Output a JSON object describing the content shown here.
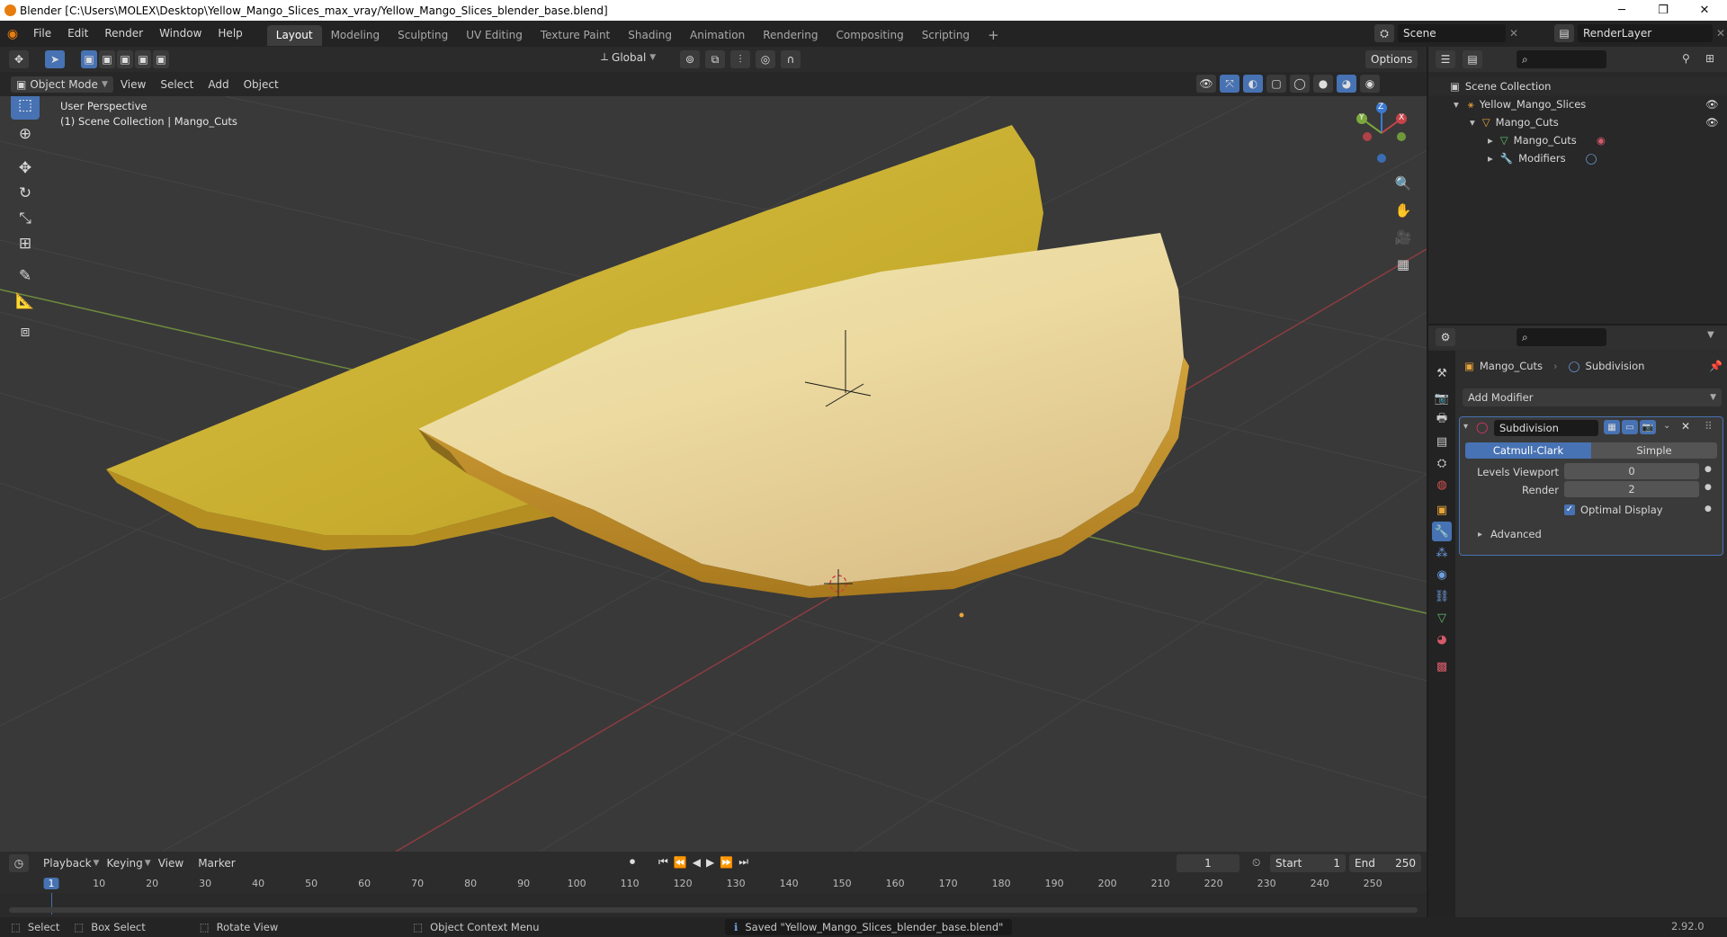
{
  "window": {
    "title": "Blender [C:\\Users\\MOLEX\\Desktop\\Yellow_Mango_Slices_max_vray/Yellow_Mango_Slices_blender_base.blend]",
    "minimize": "─",
    "maximize": "❐",
    "close": "✕"
  },
  "menu": [
    "File",
    "Edit",
    "Render",
    "Window",
    "Help"
  ],
  "workspaces": [
    "Layout",
    "Modeling",
    "Sculpting",
    "UV Editing",
    "Texture Paint",
    "Shading",
    "Animation",
    "Rendering",
    "Compositing",
    "Scripting"
  ],
  "active_workspace": "Layout",
  "add_workspace": "+",
  "scene": {
    "name": "Scene",
    "render_layer": "RenderLayer"
  },
  "viewport_toolbar": {
    "orientation": "Global",
    "options": "Options"
  },
  "viewport_header": {
    "mode": "Object Mode",
    "menus": [
      "View",
      "Select",
      "Add",
      "Object"
    ]
  },
  "viewport": {
    "perspective": "User Perspective",
    "collection_info": "(1) Scene Collection | Mango_Cuts",
    "gizmo": {
      "x": "X",
      "y": "Y",
      "z": "Z"
    }
  },
  "outliner": {
    "root": "Scene Collection",
    "items": [
      {
        "label": "Yellow_Mango_Slices",
        "depth": 1,
        "expand": "▾"
      },
      {
        "label": "Mango_Cuts",
        "depth": 2,
        "expand": "▾"
      },
      {
        "label": "Mango_Cuts",
        "depth": 3,
        "expand": "▸"
      },
      {
        "label": "Modifiers",
        "depth": 3,
        "expand": "▸"
      }
    ]
  },
  "properties": {
    "object_name": "Mango_Cuts",
    "modifier_breadcrumb": "Subdivision",
    "add_modifier": "Add Modifier",
    "modifier": {
      "name": "Subdivision",
      "type_options": [
        "Catmull-Clark",
        "Simple"
      ],
      "selected_type": "Catmull-Clark",
      "levels_viewport_label": "Levels Viewport",
      "levels_viewport": "0",
      "render_label": "Render",
      "render": "2",
      "optimal_display_label": "Optimal Display",
      "optimal_display": true,
      "advanced_label": "Advanced"
    }
  },
  "timeline": {
    "menus": [
      "Playback",
      "Keying",
      "View",
      "Marker"
    ],
    "current_frame": "1",
    "start_label": "Start",
    "start": "1",
    "end_label": "End",
    "end": "250",
    "ticks": [
      "1",
      "10",
      "20",
      "30",
      "40",
      "50",
      "60",
      "70",
      "80",
      "90",
      "100",
      "110",
      "120",
      "130",
      "140",
      "150",
      "160",
      "170",
      "180",
      "190",
      "200",
      "210",
      "220",
      "230",
      "240",
      "250"
    ]
  },
  "statusbar": {
    "select": "Select",
    "box_select": "Box Select",
    "rotate_view": "Rotate View",
    "context_menu": "Object Context Menu",
    "message": "Saved \"Yellow_Mango_Slices_blender_base.blend\"",
    "version": "2.92.0"
  },
  "colors": {
    "accent": "#4772b3",
    "selected_outline": "#e8a43a",
    "x_axis": "#c6444a",
    "y_axis": "#7ba83c",
    "z_axis": "#3b7ad2",
    "mango_skin": "#c6a52a",
    "mango_flesh": "#ebe0a3"
  }
}
